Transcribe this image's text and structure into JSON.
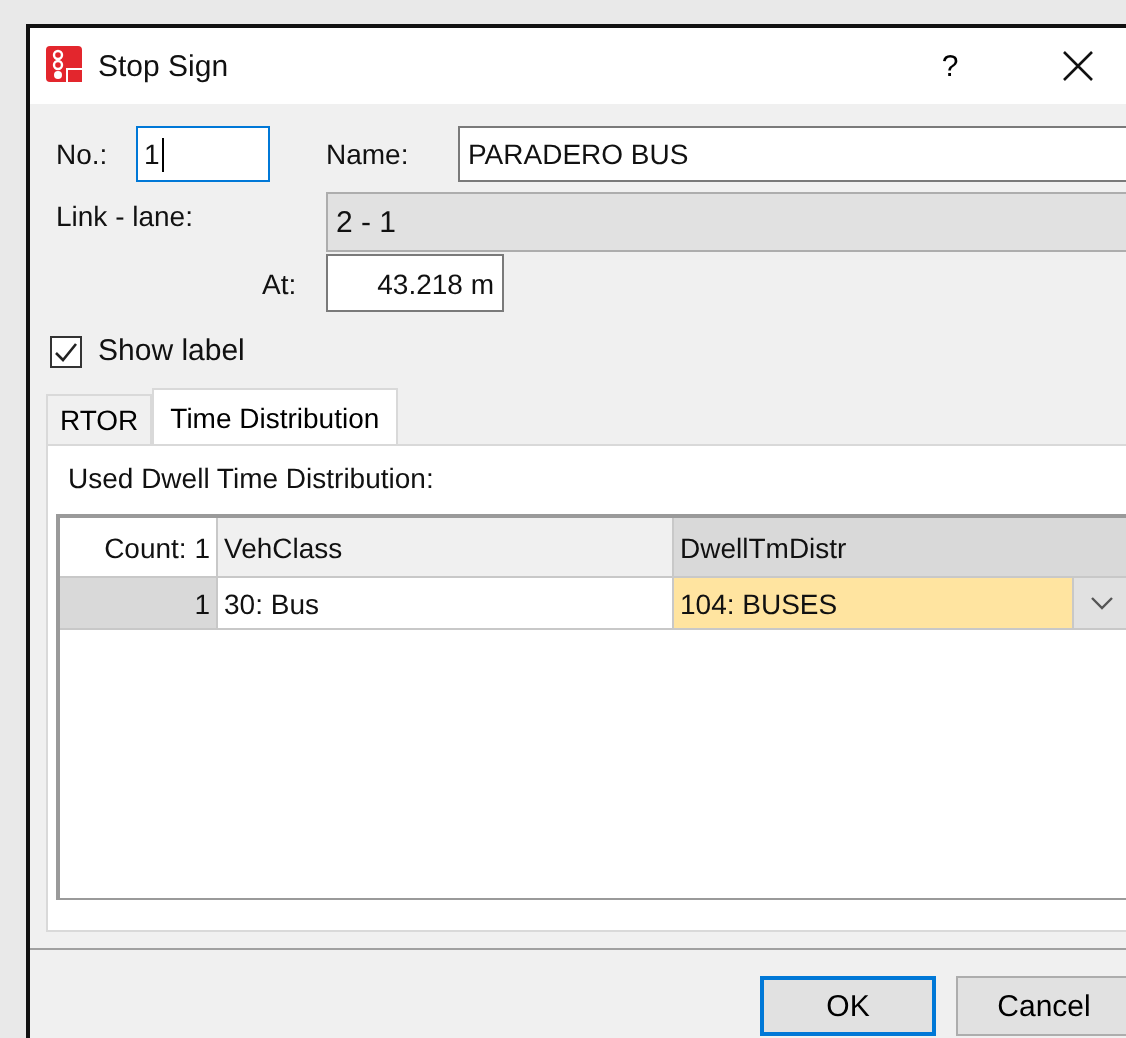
{
  "window": {
    "title": "Stop Sign",
    "help": "?"
  },
  "number": {
    "label": "No.:",
    "value": "1",
    "focused": true
  },
  "name": {
    "label": "Name:",
    "value": "PARADERO BUS"
  },
  "link_lane": {
    "label": "Link - lane:",
    "value": "2 - 1"
  },
  "at": {
    "label": "At:",
    "value": "43.218 m"
  },
  "show_label": {
    "label": "Show label",
    "checked": true
  },
  "tabs": [
    {
      "label": "RTOR",
      "selected": false
    },
    {
      "label": "Time Distribution",
      "selected": true
    }
  ],
  "section_label": "Used Dwell Time Distribution:",
  "table": {
    "columns": [
      "Count: 1",
      "VehClass",
      "DwellTmDistr"
    ],
    "rows": [
      {
        "cells": [
          {
            "text": "1",
            "selected": false,
            "kind": "header"
          },
          {
            "text": "30: Bus",
            "selected": false,
            "kind": "text"
          },
          {
            "text": "104: BUSES",
            "selected": true,
            "kind": "dropdown"
          }
        ]
      }
    ]
  },
  "buttons": [
    {
      "label": "OK",
      "default": true
    },
    {
      "label": "Cancel",
      "default": false
    }
  ]
}
